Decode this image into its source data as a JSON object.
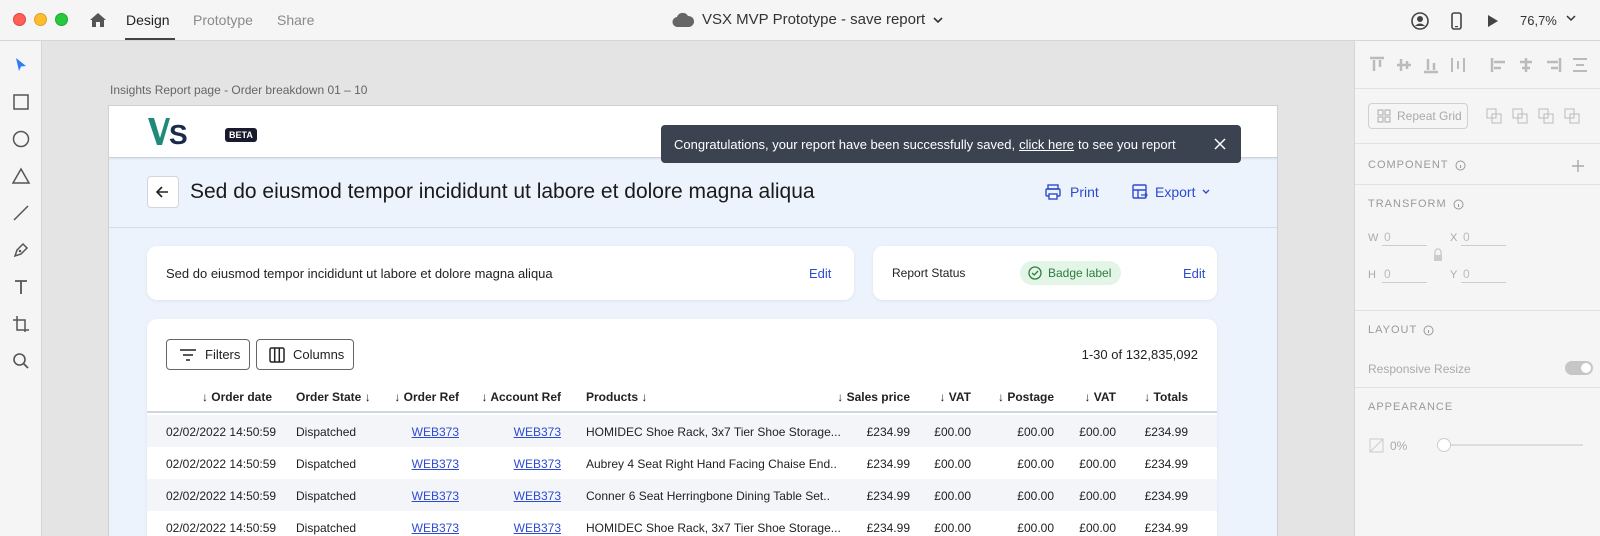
{
  "titlebar": {
    "tabs": [
      {
        "label": "Design"
      },
      {
        "label": "Prototype"
      },
      {
        "label": "Share"
      }
    ],
    "document_title": "VSX MVP Prototype - save report",
    "zoom": "76,7%"
  },
  "canvas": {
    "artboard_label": "Insights Report page - Order breakdown 01 – 10"
  },
  "app": {
    "logo_text": "VS",
    "beta_label": "BETA",
    "toast": {
      "text_before": "Congratulations, your report have been successfully saved,",
      "link_text": "click here",
      "text_after": "to see you report"
    },
    "page_title": "Sed do eiusmod tempor incididunt ut labore et dolore magna aliqua",
    "print_label": "Print",
    "export_label": "Export",
    "description_card": {
      "text": "Sed do eiusmod tempor incididunt ut labore et dolore magna aliqua",
      "edit_label": "Edit"
    },
    "status_card": {
      "label": "Report Status",
      "badge": "Badge label",
      "edit_label": "Edit"
    },
    "table": {
      "filters_label": "Filters",
      "columns_label": "Columns",
      "count": "1-30 of 132,835,092",
      "headers": [
        "↓ Order date",
        "Order State ↓",
        "↓ Order Ref",
        "↓ Account Ref",
        "Products ↓",
        "↓ Sales price",
        "↓ VAT",
        "↓ Postage",
        "↓ VAT",
        "↓ Totals"
      ],
      "rows": [
        [
          "02/02/2022 14:50:59",
          "Dispatched",
          "WEB373",
          "WEB373",
          "HOMIDEC Shoe Rack, 3x7 Tier Shoe Storage...",
          "£234.99",
          "£00.00",
          "£00.00",
          "£00.00",
          "£234.99"
        ],
        [
          "02/02/2022 14:50:59",
          "Dispatched",
          "WEB373",
          "WEB373",
          "Aubrey 4 Seat Right Hand Facing Chaise End..",
          "£234.99",
          "£00.00",
          "£00.00",
          "£00.00",
          "£234.99"
        ],
        [
          "02/02/2022 14:50:59",
          "Dispatched",
          "WEB373",
          "WEB373",
          "Conner 6 Seat Herringbone Dining Table Set..",
          "£234.99",
          "£00.00",
          "£00.00",
          "£00.00",
          "£234.99"
        ],
        [
          "02/02/2022 14:50:59",
          "Dispatched",
          "WEB373",
          "WEB373",
          "HOMIDEC Shoe Rack, 3x7 Tier Shoe Storage...",
          "£234.99",
          "£00.00",
          "£00.00",
          "£00.00",
          "£234.99"
        ]
      ]
    }
  },
  "right_panel": {
    "repeat_grid_label": "Repeat Grid",
    "component_label": "COMPONENT",
    "transform_label": "TRANSFORM",
    "w_label": "W",
    "w_value": "0",
    "x_label": "X",
    "x_value": "0",
    "h_label": "H",
    "h_value": "0",
    "y_label": "Y",
    "y_value": "0",
    "layout_label": "LAYOUT",
    "responsive_resize_label": "Responsive Resize",
    "appearance_label": "APPEARANCE",
    "opacity_value": "0%"
  },
  "colors": {
    "accent": "#2c4bd0",
    "toast_bg": "#3b4350",
    "badge_bg": "#e3f5e7",
    "badge_text": "#2e7d3e",
    "page_bg": "#edf3fc"
  }
}
